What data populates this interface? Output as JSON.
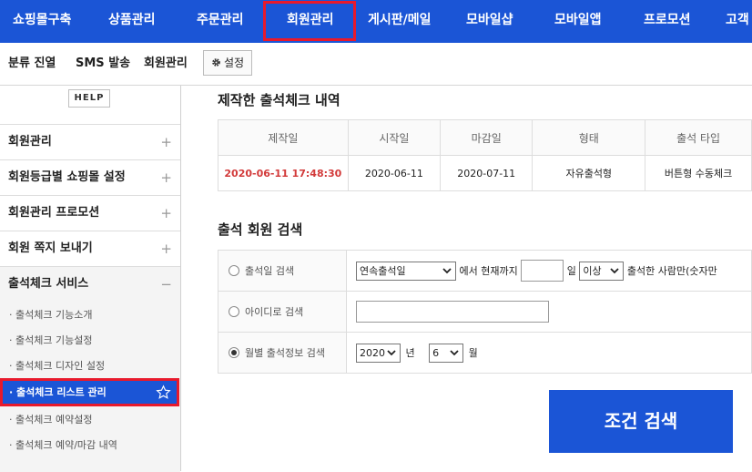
{
  "top_nav": {
    "items": [
      "쇼핑몰구축",
      "상품관리",
      "주문관리",
      "회원관리",
      "게시판/메일",
      "모바일샵",
      "모바일앱",
      "프로모션",
      "고객"
    ],
    "active": "회원관리"
  },
  "sub_nav": {
    "items": [
      "분류 진열",
      "SMS 발송",
      "회원관리"
    ],
    "settings_label": "설정"
  },
  "sidebar": {
    "help": "HELP",
    "menus": [
      "회원관리",
      "회원등급별 쇼핑몰 설정",
      "회원관리 프로모션",
      "회원 쪽지 보내기"
    ],
    "expand_symbol": "+",
    "section": {
      "title": "출석체크 서비스",
      "collapse_symbol": "−",
      "items": [
        "· 출석체크 기능소개",
        "· 출석체크 기능설정",
        "· 출석체크 디자인 설정",
        "· 출석체크 리스트 관리",
        "· 출석체크 예약설정",
        "· 출석체크 예약/마감 내역"
      ],
      "active_item": "· 출석체크 리스트 관리"
    }
  },
  "history": {
    "title": "제작한 출석체크 내역",
    "columns": [
      "제작일",
      "시작일",
      "마감일",
      "형태",
      "출석 타입"
    ],
    "row": [
      "2020-06-11 17:48:30",
      "2020-06-11",
      "2020-07-11",
      "자유출석형",
      "버튼형 수동체크"
    ]
  },
  "search": {
    "title": "출석 회원 검색",
    "rows": [
      {
        "label": "출석일 검색",
        "select1": "연속출석일",
        "text1": "에서 현재까지",
        "text2": "일",
        "select2": "이상",
        "text3": "출석한 사람만(숫자만"
      },
      {
        "label": "아이디로 검색"
      },
      {
        "label": "월별 출석정보 검색",
        "year": "2020",
        "year_unit": "년",
        "month": "6",
        "month_unit": "월"
      }
    ],
    "selected_row": 2,
    "button": "조건 검색"
  },
  "colors": {
    "brand_blue": "#1b55d6",
    "highlight_red": "#e8192c",
    "date_red": "#d23a3a"
  }
}
